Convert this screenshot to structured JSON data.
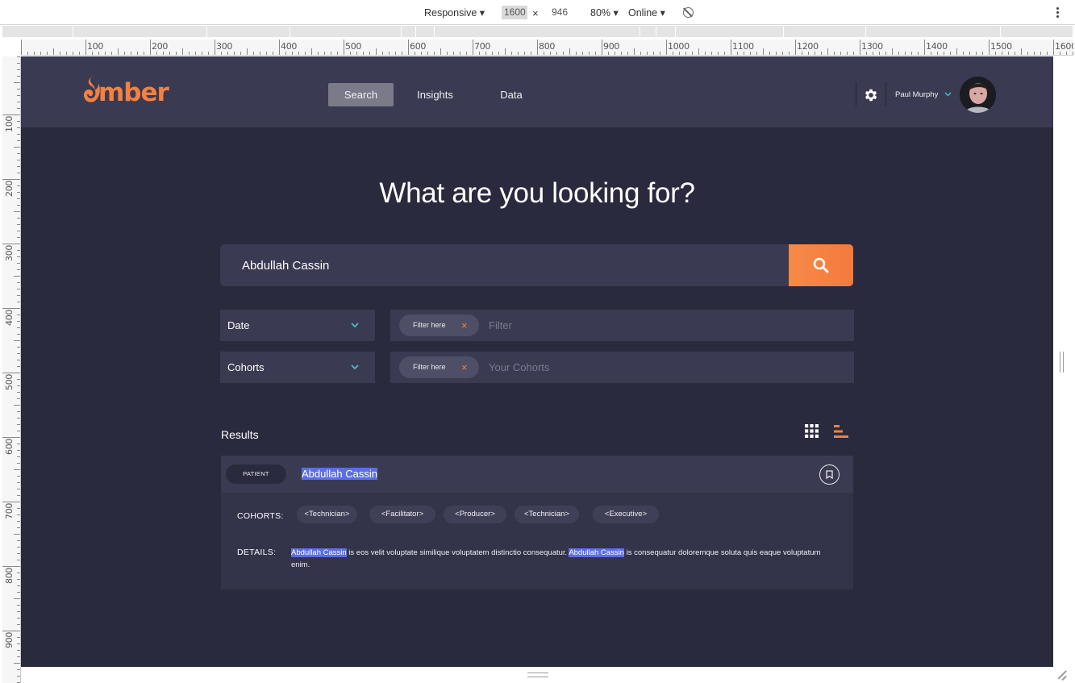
{
  "devtools": {
    "device": "Responsive ▾",
    "width": "1600",
    "times": "×",
    "height": "946",
    "zoom": "80% ▾",
    "network": "Online ▾",
    "ruler_top_labels": [
      "100",
      "200",
      "300",
      "400",
      "500",
      "600",
      "700",
      "800",
      "900",
      "1000",
      "1100",
      "1200",
      "1300",
      "1400",
      "1500",
      "1600"
    ],
    "ruler_left_labels": [
      "100",
      "200",
      "300",
      "400",
      "500",
      "600",
      "700",
      "800",
      "900"
    ]
  },
  "app": {
    "logo_text": "mber",
    "nav": {
      "search": "Search",
      "insights": "Insights",
      "data": "Data"
    },
    "user_name": "Paul Murphy",
    "headline": "What are you looking for?",
    "search": {
      "value": "Abdullah Cassin"
    },
    "filters": [
      {
        "select": "Date",
        "pill": "Filter here",
        "pill_close": "×",
        "placeholder": "Filter"
      },
      {
        "select": "Cohorts",
        "pill": "Filter here",
        "pill_close": "×",
        "placeholder": "Your Cohorts"
      }
    ],
    "results_title": "Results",
    "result": {
      "badge": "PATIENT",
      "name": "Abdullah Cassin",
      "cohorts_label": "COHORTS:",
      "cohorts": [
        "<Technician>",
        "<Facilitator>",
        "<Producer>",
        "<Technician>",
        "<Executive>"
      ],
      "details_label": "DETAILS:",
      "details_hl1": "Abdullah Cassin",
      "details_mid": " is eos velit voluptate similique voluptatem distinctio consequatur. ",
      "details_hl2": "Abdullah Cassin",
      "details_end": " is consequatur doloremque soluta quis eaque voluptatum enim."
    }
  },
  "colors": {
    "accent": "#f4813f",
    "teal": "#3fc3c3",
    "bg": "#2a2a3e",
    "panel": "#3a3a52",
    "highlight": "#5b6ee8"
  }
}
